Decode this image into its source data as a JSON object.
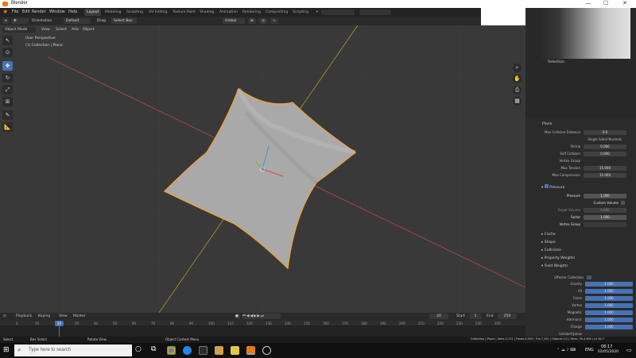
{
  "window": {
    "title": "Blender",
    "minimize": "—",
    "maximize": "☐",
    "close": "✕"
  },
  "menus": [
    "File",
    "Edit",
    "Render",
    "Window",
    "Help"
  ],
  "workspaces": [
    "Layout",
    "Modeling",
    "Sculpting",
    "UV Editing",
    "Texture Paint",
    "Shading",
    "Animation",
    "Rendering",
    "Compositing",
    "Scripting"
  ],
  "header": {
    "mode": "Object Mode",
    "view": "View",
    "select": "Select",
    "add": "Add",
    "object": "Object",
    "orientation": "Orientation",
    "orientation_value": "Default",
    "drag": "Drag",
    "drag_value": "Select Box",
    "pivot": "Global"
  },
  "viewport": {
    "perspective": "User Perspective",
    "collection": "(1) Collection | Plane"
  },
  "outliner": {
    "last_item": "Selection"
  },
  "properties": {
    "object_name": "Plane",
    "rows": [
      {
        "label": "Max Collision Distance",
        "value": "0.0"
      },
      {
        "label": "Single Sided Normals",
        "value": ""
      },
      {
        "label": "Shrink",
        "value": "0.000"
      },
      {
        "label": "Self Collision",
        "value": "0.000"
      },
      {
        "label": "Vertex Group",
        "value": ""
      },
      {
        "label": "Max Tension",
        "value": "15.000"
      },
      {
        "label": "Max Compression",
        "value": "15.000"
      }
    ],
    "pressure_section": "Pressure",
    "pressure_label": "Pressure",
    "pressure_value": "1.000",
    "custom_volume": "Custom Volume",
    "target_volume_label": "Target Volume",
    "target_volume": "0.000",
    "factor_label": "Factor",
    "factor": "1.000",
    "vertex_group_label": "Vertex Group",
    "sections": [
      "Cache",
      "Shape",
      "Collisions",
      "Property Weights",
      "Field Weights"
    ],
    "effector_collection": "Effector Collection",
    "weights": [
      {
        "label": "Gravity",
        "value": "1.000"
      },
      {
        "label": "All",
        "value": "1.000"
      },
      {
        "label": "Force",
        "value": "1.000"
      },
      {
        "label": "Vortex",
        "value": "1.000"
      },
      {
        "label": "Magnetic",
        "value": "1.000"
      },
      {
        "label": "Harmonic",
        "value": "1.000"
      },
      {
        "label": "Charge",
        "value": "1.000"
      },
      {
        "label": "Lennard-Jones",
        "value": ""
      }
    ]
  },
  "timeline": {
    "playback": "Playback",
    "keying": "Keying",
    "view": "View",
    "marker": "Marker",
    "current_frame": "20",
    "start_label": "Start",
    "start": "1",
    "end_label": "End",
    "end": "250",
    "ticks": [
      "0",
      "10",
      "20",
      "30",
      "40",
      "50",
      "60",
      "70",
      "80",
      "90",
      "100",
      "110",
      "120",
      "130",
      "140",
      "150",
      "160",
      "170",
      "180",
      "190",
      "200",
      "210",
      "220",
      "230",
      "240",
      "250"
    ]
  },
  "status": {
    "select": "Select",
    "box_select": "Box Select",
    "rotate_view": "Rotate View",
    "context_menu": "Object Context Menu",
    "stats": "Collection | Plane | Verts:3,721 | Faces:3,600 | Tris:7,200 | Objects:1/1 | Mem: 36.4 MiB | v2.82.7"
  },
  "taskbar": {
    "search_placeholder": "Type here to search",
    "lang": "ENG",
    "time": "08:17",
    "date": "02/05/2020"
  },
  "colors": {
    "accent": "#4772b3",
    "selection_outline": "#e8a33c",
    "x_axis": "#c04040",
    "y_axis": "#9a8a2a"
  }
}
